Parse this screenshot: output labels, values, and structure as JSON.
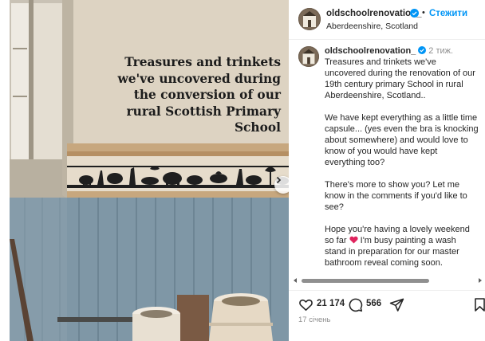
{
  "image": {
    "overlay_text": "Treasures and trinkets\nwe've uncovered during\nthe conversion of our\nrural Scottish Primary\nSchool",
    "next_icon": "chevron-right-icon"
  },
  "header": {
    "username": "oldschoolrenovation_",
    "separator": "•",
    "follow_label": "Стежити",
    "location": "Aberdeenshire, Scotland",
    "more_icon": "more-horizontal-icon"
  },
  "caption": {
    "username": "oldschoolrenovation_",
    "time": "2 тиж.",
    "paragraphs": [
      "Treasures and trinkets we've uncovered during the renovation of our 19th century  primary School in rural Aberdeenshire, Scotland..",
      "We have kept everything as a little time capsule... (yes even the bra is knocking about somewhere) and would love to know of you would have kept everything too?",
      "There's more to show you? Let me know in the comments if you'd like to see?"
    ],
    "last_paragraph_before": "Hope you're having a lovely weekend so far ",
    "last_paragraph_after": " I'm busy painting a wash stand in preparation for our master bathroom reveal coming soon."
  },
  "actions": {
    "likes": "21 174",
    "comments": "566",
    "like_icon": "heart-icon",
    "comment_icon": "comment-icon",
    "share_icon": "share-icon",
    "save_icon": "bookmark-icon"
  },
  "date": "17 січень",
  "colors": {
    "follow": "#0095f6",
    "verified": "#0095f6",
    "heart_emoji": "#e0245e",
    "muted": "#8e8e8e"
  }
}
